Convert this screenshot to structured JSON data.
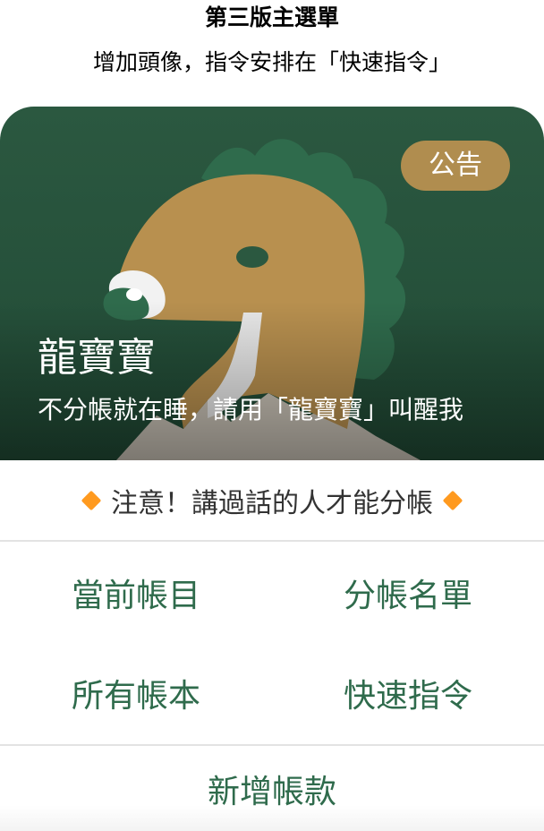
{
  "caption": {
    "title": "第三版主選單",
    "subtitle": "增加頭像，指令安排在「快速指令」"
  },
  "banner": {
    "badge_label": "公告",
    "bot_name": "龍寶寶",
    "bot_description": "不分帳就在睡，請用「龍寶寶」叫醒我",
    "background_color": "#2b5840",
    "mascot_color": "#b8904f"
  },
  "notice": {
    "text": "注意！講過話的人才能分帳",
    "icon": "orange-diamond-icon"
  },
  "menu": {
    "buttons": [
      {
        "label": "當前帳目"
      },
      {
        "label": "分帳名單"
      },
      {
        "label": "所有帳本"
      },
      {
        "label": "快速指令"
      }
    ],
    "bottom_button": {
      "label": "新增帳款"
    }
  },
  "colors": {
    "accent_green": "#2f6b4c",
    "badge_gold": "#b08d4f",
    "notice_diamond": "#ff9a1f"
  }
}
